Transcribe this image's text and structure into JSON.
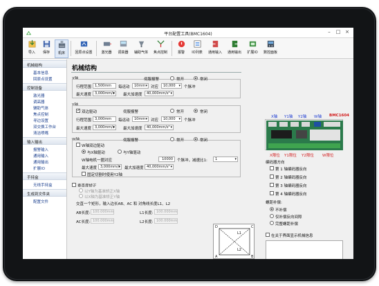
{
  "window": {
    "title": "平台配置工具(BMC1604)"
  },
  "toolbar": {
    "items": [
      {
        "label": "导入",
        "icon": "import-icon"
      },
      {
        "label": "保存",
        "icon": "save-icon"
      },
      {
        "label": "机床",
        "icon": "machine-icon"
      },
      {
        "label": "回原点设置",
        "icon": "home-setting-icon"
      },
      {
        "label": "激光器",
        "icon": "laser-icon"
      },
      {
        "label": "调高器",
        "icon": "height-controller-icon"
      },
      {
        "label": "辅助气体",
        "icon": "gas-icon"
      },
      {
        "label": "焦点控制",
        "icon": "focus-icon"
      },
      {
        "label": "报警",
        "icon": "alarm-icon"
      },
      {
        "label": "IO列表",
        "icon": "io-list-icon"
      },
      {
        "label": "通用输入",
        "icon": "input-icon"
      },
      {
        "label": "通用输出",
        "icon": "output-icon"
      },
      {
        "label": "扩展IO",
        "icon": "extend-io-icon"
      },
      {
        "label": "数控面板",
        "icon": "panel-icon"
      }
    ]
  },
  "sidebar": {
    "groups": [
      {
        "title": "机械结构",
        "items": [
          "基本信息",
          "回原点设置"
        ]
      },
      {
        "title": "控制设备",
        "items": [
          "激光器",
          "调高器",
          "辅助气体",
          "焦点控制",
          "寻边设置",
          "双交换工作台",
          "清洁喷嘴"
        ]
      },
      {
        "title": "输入输出",
        "items": [
          "报警输入",
          "通用输入",
          "通用输出",
          "扩展IO"
        ]
      },
      {
        "title": "手持盒",
        "items": [
          "无线手持盒"
        ]
      },
      {
        "title": "生成到文件夹",
        "items": [
          "配置文件"
        ]
      }
    ]
  },
  "main": {
    "heading": "机械结构",
    "x": {
      "title": "X轴",
      "travel_label": "行程范围",
      "travel": "1,500mm",
      "pulse_label": "每运动",
      "pulse_unit": "10mm",
      "pulse_mid": "对应",
      "pulses": "10,000",
      "pulses_unit": "个脉冲",
      "speed_label": "最大速度",
      "speed": "3,000mm/s",
      "accel_label": "最大加速度",
      "accel": "40,000mm/s²",
      "servo_label": "伺服报警",
      "opt_no": "常开",
      "opt_nc": "常闭"
    },
    "y": {
      "title": "Y轴",
      "dual_label": "双边驱动",
      "travel_label": "行程范围",
      "travel": "3,000mm",
      "pulse_label": "每运动",
      "pulse_unit": "10mm",
      "pulse_mid": "对应",
      "pulses": "10,000",
      "pulses_unit": "个脉冲",
      "speed_label": "最大速度",
      "speed": "3,000mm/s",
      "accel_label": "最大加速度",
      "accel": "40,000mm/s²",
      "servo_label": "伺服报警",
      "opt_no": "常开",
      "opt_nc": "常闭"
    },
    "w": {
      "title": "W轴",
      "enable_label": "W轴双边驱动",
      "mode_x": "与X轴驱动",
      "mode_y": "与Y轴驱动",
      "per_rev_label": "W轴电机一圈对应",
      "per_rev": "10000",
      "pulses_unit": "个脉冲，减速比1:",
      "ratio": "1",
      "speed_label": "最大速度",
      "speed": "3,000mm/s",
      "accel_label": "最大加速度",
      "accel": "40,000mm/s²",
      "fixed_label": "固定切割时使用Y2轴",
      "servo_label": "伺服报警",
      "opt_no": "常开",
      "opt_nc": "常闭"
    },
    "perp": {
      "label": "垂直度矫正",
      "opt1": "以Y轴为基准矫正X轴",
      "opt2": "以X轴为基准矫正Y轴",
      "hint": "交直一个矩形，输入边长AB、AC 和 对角线长度L1、L2",
      "ab_label": "AB长度:",
      "ab": "100.000mm",
      "ac_label": "AC长度:",
      "ac": "100.000mm",
      "l1_label": "L1长度:",
      "l1": "100.000mm",
      "l2_label": "L2长度:",
      "l2": "100.000mm",
      "diagram_labels": [
        "D",
        "C",
        "A",
        "B",
        "L1",
        "L2"
      ]
    },
    "board": {
      "axes": [
        "X轴",
        "Y1轴",
        "Y2轴",
        "W轴"
      ],
      "model": "BMC1604",
      "limits": [
        "X限位",
        "Y1限位",
        "Y2限位",
        "W限位"
      ]
    },
    "encoder": {
      "title": "编码器方向",
      "items": [
        "第 1 轴编码器反向",
        "第 2 轴编码器反向",
        "第 3 轴编码器反向",
        "第 4 轴编码器反向"
      ]
    },
    "backlash": {
      "title": "螺距补偿:",
      "options": [
        "不补偿",
        "仅补偿反向间隙",
        "完整螺距补偿"
      ]
    },
    "about": {
      "label": "在关于界面显示机械信息"
    }
  },
  "colors": {
    "accent": "#1a3f8e",
    "red": "#d11a1a",
    "blue": "#1d3bd1"
  }
}
